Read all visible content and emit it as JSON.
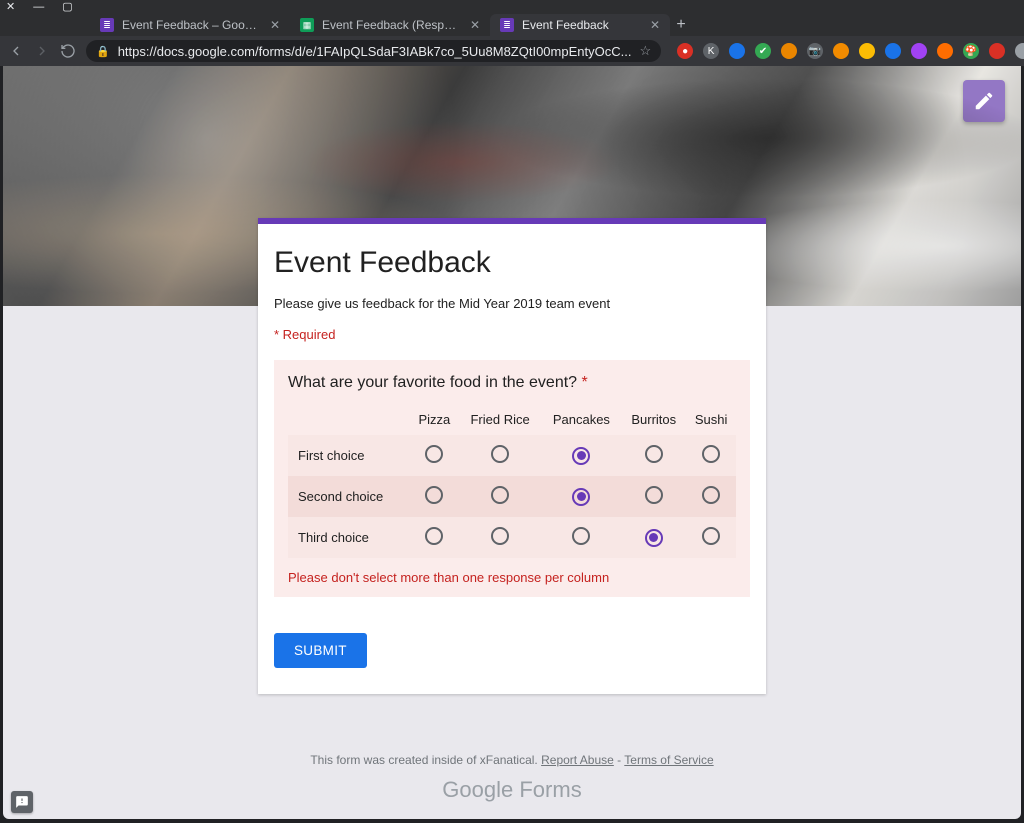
{
  "browser": {
    "tabs": [
      {
        "label": "Event Feedback – Google Forms",
        "favicon": "forms",
        "active": false
      },
      {
        "label": "Event Feedback (Responses) - G",
        "favicon": "sheets",
        "active": false
      },
      {
        "label": "Event Feedback",
        "favicon": "forms",
        "active": true
      }
    ],
    "url": "https://docs.google.com/forms/d/e/1FAIpQLSdaF3IABk7co_5Uu8M8ZQtI00mpEntyOcC..."
  },
  "form": {
    "title": "Event Feedback",
    "description": "Please give us feedback for the Mid Year 2019 team event",
    "required_note": "* Required",
    "question": {
      "title": "What are your favorite food in the event?",
      "required": true,
      "columns": [
        "Pizza",
        "Fried Rice",
        "Pancakes",
        "Burritos",
        "Sushi"
      ],
      "rows": [
        "First choice",
        "Second choice",
        "Third choice"
      ],
      "selected": {
        "First choice": "Pancakes",
        "Second choice": "Pancakes",
        "Third choice": "Burritos"
      },
      "error": "Please don't select more than one response per column"
    },
    "submit_label": "SUBMIT"
  },
  "footer": {
    "prefix": "This form was created inside of xFanatical. ",
    "report_abuse": "Report Abuse",
    "sep": " - ",
    "terms": "Terms of Service",
    "logo_a": "Google",
    "logo_b": " Forms"
  }
}
